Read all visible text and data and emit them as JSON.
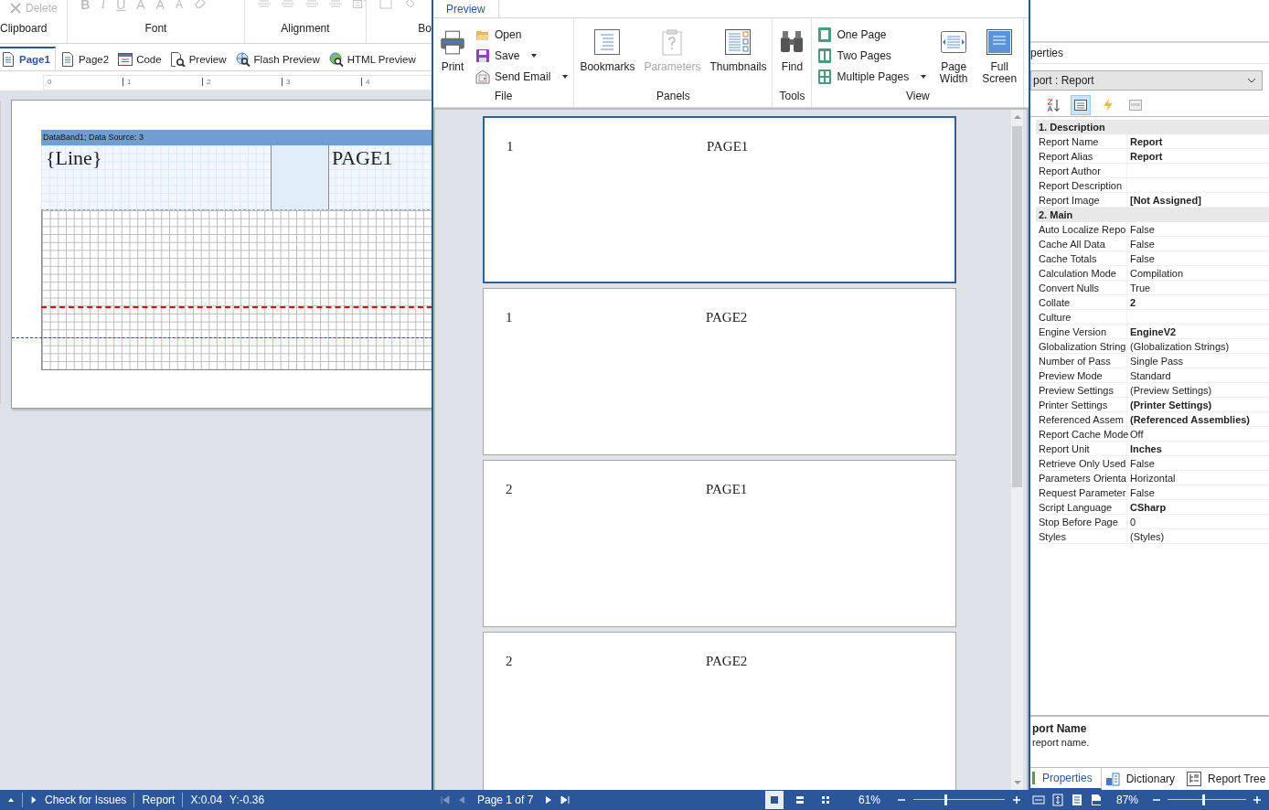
{
  "designer": {
    "ribbon_groups": [
      {
        "label": "Clipboard"
      },
      {
        "label": "Font"
      },
      {
        "label": "Alignment"
      },
      {
        "label": "Bo"
      }
    ],
    "delete_button": {
      "label": "Delete",
      "disabled": true
    },
    "font_glyphs": [
      {
        "text": "B",
        "kind": "bold"
      },
      {
        "text": "I",
        "kind": "italic"
      },
      {
        "text": "U",
        "kind": "underline"
      },
      {
        "text": "A",
        "kind": "color"
      },
      {
        "text": "A",
        "kind": "grow"
      },
      {
        "text": "A",
        "kind": "shrink"
      }
    ],
    "tabs": [
      {
        "label": "Page1",
        "selected": true,
        "kind": "page"
      },
      {
        "label": "Page2",
        "selected": false,
        "kind": "page"
      },
      {
        "label": "Code",
        "selected": false,
        "kind": "code"
      },
      {
        "label": "Preview",
        "selected": false,
        "kind": "preview"
      },
      {
        "label": "Flash Preview",
        "selected": false,
        "kind": "flash"
      },
      {
        "label": "HTML Preview",
        "selected": false,
        "kind": "html"
      }
    ],
    "ruler_marks": [
      "0",
      "1",
      "2",
      "3",
      "4"
    ],
    "band": {
      "header": "DataBand1; Data Source: 3",
      "cells": [
        "{Line}",
        "PAGE1"
      ]
    },
    "status": {
      "check": "Check for Issues",
      "report": "Report",
      "x": "X:0.04",
      "y": "Y:-0.36"
    }
  },
  "preview": {
    "tab": "Preview",
    "file": {
      "label": "File",
      "print": "Print",
      "commands": [
        {
          "label": "Open",
          "kind": "open",
          "dropdown": false
        },
        {
          "label": "Save",
          "kind": "save",
          "dropdown": true
        },
        {
          "label": "Send Email",
          "kind": "email",
          "dropdown": true
        }
      ]
    },
    "panels": {
      "label": "Panels",
      "buttons": [
        {
          "label": "Bookmarks",
          "kind": "bookmarks",
          "disabled": false
        },
        {
          "label": "Parameters",
          "kind": "parameters",
          "disabled": true
        },
        {
          "label": "Thumbnails",
          "kind": "thumbnails",
          "disabled": false
        }
      ]
    },
    "tools": {
      "label": "Tools",
      "find": "Find"
    },
    "view": {
      "label": "View",
      "commands": [
        {
          "label": "One Page",
          "kind": "one",
          "dropdown": false
        },
        {
          "label": "Two Pages",
          "kind": "two",
          "dropdown": false
        },
        {
          "label": "Multiple Pages",
          "kind": "multi",
          "dropdown": true
        }
      ],
      "buttons": [
        {
          "label": "Page Width",
          "kind": "width"
        },
        {
          "label": "Full Screen",
          "kind": "full"
        }
      ]
    },
    "pages": [
      {
        "number": "1",
        "title": "PAGE1",
        "selected": true
      },
      {
        "number": "1",
        "title": "PAGE2",
        "selected": false
      },
      {
        "number": "2",
        "title": "PAGE1",
        "selected": false
      },
      {
        "number": "2",
        "title": "PAGE2",
        "selected": false
      }
    ],
    "status": {
      "page_info": "Page 1 of 7",
      "view_modes": [
        {
          "kind": "single",
          "selected": true
        },
        {
          "kind": "continuous",
          "selected": false
        },
        {
          "kind": "multiple",
          "selected": false
        }
      ],
      "zoom": "61%",
      "zoom_slider": {
        "level": 0.35
      }
    }
  },
  "properties": {
    "title": "perties",
    "object": "port : Report",
    "toolbar": [
      {
        "kind": "sort",
        "selected": false
      },
      {
        "kind": "grid",
        "selected": true
      },
      {
        "kind": "events",
        "selected": false
      },
      {
        "kind": "window",
        "selected": false
      }
    ],
    "categories": [
      {
        "title": "1. Description",
        "rows": [
          {
            "name": "Report Name",
            "value": "Report",
            "modified": true
          },
          {
            "name": "Report Alias",
            "value": "Report",
            "modified": true
          },
          {
            "name": "Report Author"
          },
          {
            "name": "Report Description"
          },
          {
            "name": "Report Image",
            "value": "[Not Assigned]",
            "modified": true
          }
        ]
      },
      {
        "title": "2. Main",
        "rows": [
          {
            "name": "Auto Localize Repo",
            "value": "False",
            "modified": false
          },
          {
            "name": "Cache All Data",
            "value": "False",
            "modified": false
          },
          {
            "name": "Cache Totals",
            "value": "False",
            "modified": false
          },
          {
            "name": "Calculation Mode",
            "value": "Compilation",
            "modified": false
          },
          {
            "name": "Convert Nulls",
            "value": "True",
            "modified": false
          },
          {
            "name": "Collate",
            "value": "2",
            "modified": true
          },
          {
            "name": "Culture"
          },
          {
            "name": "Engine Version",
            "value": "EngineV2",
            "modified": true
          },
          {
            "name": "Globalization String",
            "value": "(Globalization Strings)",
            "modified": false
          },
          {
            "name": "Number of Pass",
            "value": "Single Pass",
            "modified": false
          },
          {
            "name": "Preview Mode",
            "value": "Standard",
            "modified": false
          },
          {
            "name": "Preview Settings",
            "value": "(Preview Settings)",
            "modified": false
          },
          {
            "name": "Printer Settings",
            "value": "(Printer Settings)",
            "modified": true
          },
          {
            "name": "Referenced Assem",
            "value": "(Referenced Assemblies)",
            "modified": true
          },
          {
            "name": "Report Cache Mode",
            "value": "Off",
            "modified": false
          },
          {
            "name": "Report Unit",
            "value": "Inches",
            "modified": true
          },
          {
            "name": "Retrieve Only Used",
            "value": "False",
            "modified": false
          },
          {
            "name": "Parameters Orienta",
            "value": "Horizontal",
            "modified": false
          },
          {
            "name": "Request Parameter",
            "value": "False",
            "modified": false
          },
          {
            "name": "Script Language",
            "value": "CSharp",
            "modified": true
          },
          {
            "name": "Stop Before Page",
            "value": "0",
            "modified": false
          },
          {
            "name": "Styles",
            "value": "(Styles)",
            "modified": false
          }
        ]
      }
    ],
    "description": {
      "title": "port Name",
      "text": "report name."
    },
    "tabs": [
      {
        "label": "Properties",
        "selected": true,
        "kind": "props"
      },
      {
        "label": "Dictionary",
        "selected": false,
        "kind": "dict"
      },
      {
        "label": "Report Tree",
        "selected": false,
        "kind": "tree"
      }
    ],
    "status": {
      "zoom": "87%",
      "zoom_slider": {
        "level": 0.45
      }
    }
  }
}
